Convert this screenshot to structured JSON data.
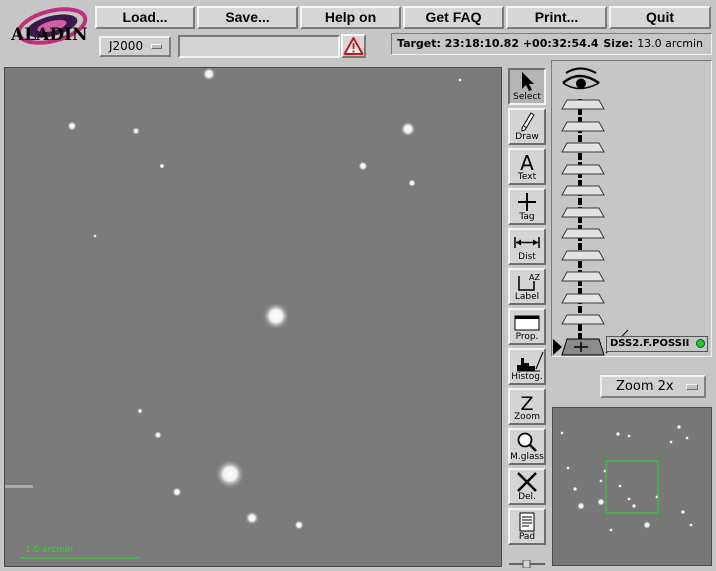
{
  "app": {
    "logo_text": "ALADIN"
  },
  "menu": [
    {
      "id": "load",
      "label": "Load..."
    },
    {
      "id": "save",
      "label": "Save..."
    },
    {
      "id": "help",
      "label": "Help on"
    },
    {
      "id": "faq",
      "label": "Get FAQ"
    },
    {
      "id": "print",
      "label": "Print..."
    },
    {
      "id": "quit",
      "label": "Quit"
    }
  ],
  "locator": {
    "frame": "J2000",
    "input_value": "",
    "warning_icon": "warning-triangle-icon"
  },
  "info": {
    "target_label": "Target:",
    "target_value": "23:18:10.82 +00:32:54.4",
    "size_label": "Size:",
    "size_value": "13.0 arcmin"
  },
  "view": {
    "scale_label": "1.0 arcmin",
    "scale_color": "#20e020"
  },
  "tools": [
    {
      "id": "select",
      "label": "Select",
      "icon": "arrow-pointer-icon",
      "active": true
    },
    {
      "id": "draw",
      "label": "Draw",
      "icon": "pencil-icon"
    },
    {
      "id": "text",
      "label": "Text",
      "icon": "text-a-icon"
    },
    {
      "id": "tag",
      "label": "Tag",
      "icon": "plus-cross-icon"
    },
    {
      "id": "dist",
      "label": "Dist",
      "icon": "distance-arrow-icon"
    },
    {
      "id": "label",
      "label": "Label",
      "icon": "label-az-icon"
    },
    {
      "id": "prop",
      "label": "Prop.",
      "icon": "window-icon"
    },
    {
      "id": "histog",
      "label": "Histog.",
      "icon": "histogram-icon"
    },
    {
      "id": "zoom",
      "label": "Zoom",
      "icon": "zoom-z-icon"
    },
    {
      "id": "mglass",
      "label": "M.glass",
      "icon": "magnifier-icon"
    },
    {
      "id": "del",
      "label": "Del.",
      "icon": "delete-x-icon"
    },
    {
      "id": "pad",
      "label": "Pad",
      "icon": "notepad-icon"
    }
  ],
  "stack": {
    "plane_name": "DSS2.F.POSSII",
    "status_color": "#22cc22",
    "eye_icon": "eye-icon"
  },
  "zoom": {
    "value": "Zoom 2x"
  }
}
